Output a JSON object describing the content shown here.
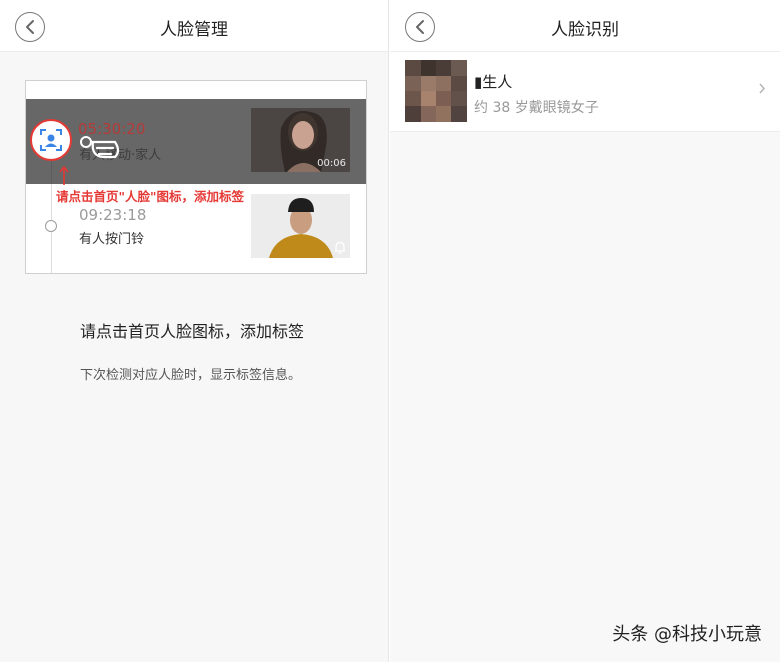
{
  "left_pane": {
    "nav": {
      "title": "人脸管理"
    },
    "preview": {
      "event1": {
        "time": "05:30:20",
        "desc": "有人移动·家人",
        "duration": "00:06"
      },
      "event2": {
        "time": "09:23:18",
        "desc": "有人按门铃"
      },
      "hint": "请点击首页\"人脸\"图标，添加标签"
    },
    "instruction": "请点击首页人脸图标，添加标签",
    "subtext": "下次检测对应人脸时，显示标签信息。"
  },
  "right_pane": {
    "nav": {
      "title": "人脸识别"
    },
    "face_item": {
      "name": "▮生人",
      "desc": "约 38 岁戴眼镜女子"
    }
  },
  "watermark": "头条 @科技小玩意",
  "colors": {
    "accent_red": "#e53935",
    "face_icon_blue": "#3a84e6"
  }
}
